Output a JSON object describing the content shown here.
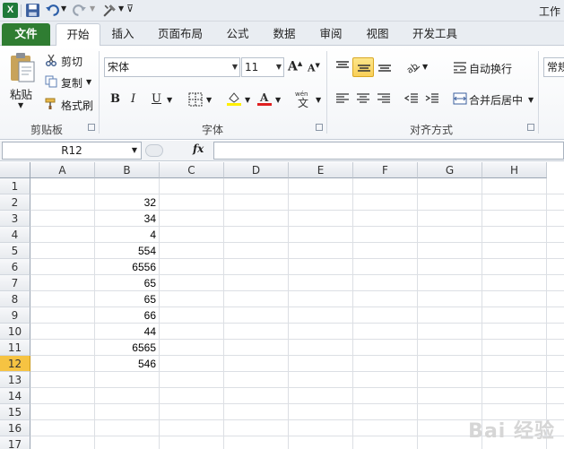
{
  "window": {
    "title_fragment": "工作"
  },
  "quick_access": {
    "icons": [
      "excel-logo",
      "save",
      "undo",
      "redo",
      "tools",
      "customize"
    ]
  },
  "ribbon_tabs": [
    {
      "label": "文件"
    },
    {
      "label": "开始"
    },
    {
      "label": "插入"
    },
    {
      "label": "页面布局"
    },
    {
      "label": "公式"
    },
    {
      "label": "数据"
    },
    {
      "label": "审阅"
    },
    {
      "label": "视图"
    },
    {
      "label": "开发工具"
    }
  ],
  "clipboard": {
    "paste_label": "粘贴",
    "cut_label": "剪切",
    "copy_label": "复制",
    "format_painter_label": "格式刷",
    "group_label": "剪贴板"
  },
  "font": {
    "font_name": "宋体",
    "font_size": "11",
    "bold": "B",
    "italic": "I",
    "underline": "U",
    "group_label": "字体"
  },
  "alignment": {
    "wrap_text_label": "自动换行",
    "merge_center_label": "合并后居中",
    "group_label": "对齐方式"
  },
  "number": {
    "format_value": "常规"
  },
  "formula_bar": {
    "name_box": "R12",
    "fx_label": "fx",
    "formula": ""
  },
  "sheet": {
    "columns": [
      "A",
      "B",
      "C",
      "D",
      "E",
      "F",
      "G",
      "H"
    ],
    "rows": [
      "1",
      "2",
      "3",
      "4",
      "5",
      "6",
      "7",
      "8",
      "9",
      "10",
      "11",
      "12",
      "13",
      "14",
      "15",
      "16",
      "17"
    ],
    "active_row": "12",
    "column_b_values": [
      "",
      "32",
      "34",
      "4",
      "554",
      "6556",
      "65",
      "65",
      "66",
      "44",
      "6565",
      "546"
    ]
  },
  "watermark": {
    "text": "Bai 经验"
  },
  "colors": {
    "file_tab": "#2f7d32",
    "active_row_header": "#f6c342",
    "highlight_button": "#f9cf58"
  }
}
